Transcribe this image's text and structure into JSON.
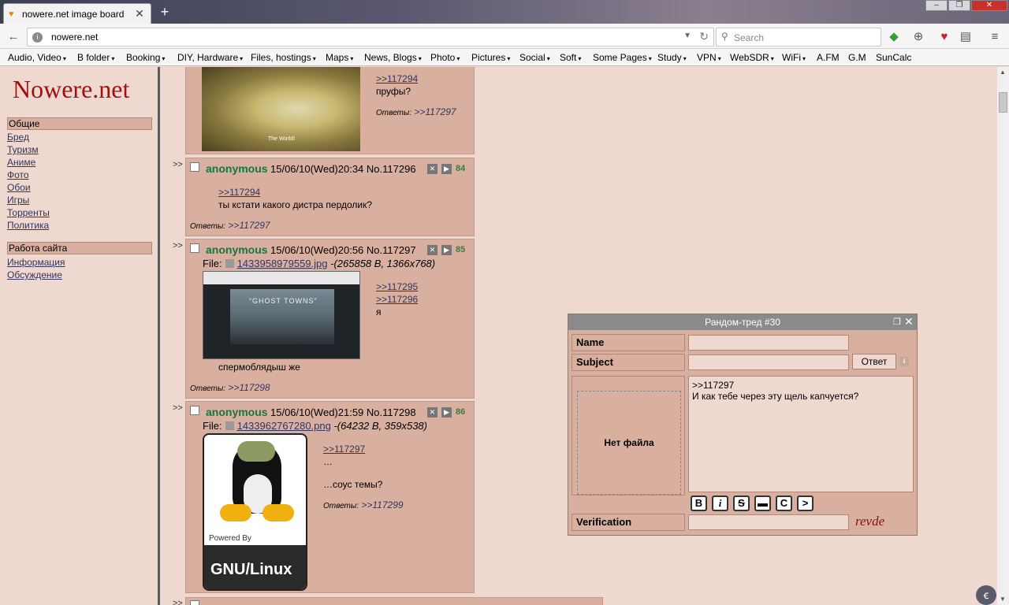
{
  "browser": {
    "tab_title": "nowere.net image board",
    "new_tab": "+",
    "url": "nowere.net",
    "search_placeholder": "Search",
    "bookmarks": [
      {
        "label": "Audio, Video",
        "arrow": "▾"
      },
      {
        "label": "B folder",
        "arrow": "▾"
      },
      {
        "label": "Booking",
        "arrow": "▾"
      },
      {
        "label": "DIY, Hardware",
        "arrow": "▾"
      },
      {
        "label": "Files, hostings",
        "arrow": "▾"
      },
      {
        "label": "Maps",
        "arrow": "▾"
      },
      {
        "label": "News, Blogs",
        "arrow": "▾"
      },
      {
        "label": "Photo",
        "arrow": "▾"
      },
      {
        "label": "Pictures",
        "arrow": "▾"
      },
      {
        "label": "Social",
        "arrow": "▾"
      },
      {
        "label": "Soft",
        "arrow": "▾"
      },
      {
        "label": "Some Pages",
        "arrow": "▾"
      },
      {
        "label": "Study",
        "arrow": "▾"
      },
      {
        "label": "VPN",
        "arrow": "▾"
      },
      {
        "label": "WebSDR",
        "arrow": "▾"
      },
      {
        "label": "WiFi",
        "arrow": "▾"
      },
      {
        "label": "A.FM",
        "arrow": ""
      },
      {
        "label": "G.M",
        "arrow": ""
      },
      {
        "label": "SunCalc",
        "arrow": ""
      }
    ]
  },
  "sidebar": {
    "site_title": "Nowere.net",
    "section1": "Общие",
    "links1": [
      "Бред",
      "Туризм",
      "Аниме",
      "Фото",
      "Обои",
      "Игры",
      "Торренты",
      "Политика"
    ],
    "section2": "Работа сайта",
    "links2": [
      "Информация",
      "Обсуждение"
    ]
  },
  "posts": [
    {
      "ref": ">>117294",
      "text": "пруфы?",
      "replies_label": "Ответы:",
      "replies": ">>117297",
      "img_caption": "The World!"
    },
    {
      "arrow": ">>",
      "name": "anonymous",
      "meta": "15/06/10(Wed)20:34 No.117296",
      "count": "84",
      "ref": ">>117294",
      "text": "ты кстати какого дистра пердолик?",
      "replies_label": "Ответы:",
      "replies": ">>117297"
    },
    {
      "arrow": ">>",
      "name": "anonymous",
      "meta": "15/06/10(Wed)20:56 No.117297",
      "count": "85",
      "file_label": "File:",
      "file_name": "1433958979559.jpg",
      "file_info": " -(265858 B, 1366x768)",
      "refs": [
        ">>117295",
        ">>117296"
      ],
      "text1": "я",
      "text2": "спермоблядыш же",
      "replies_label": "Ответы:",
      "replies": ">>117298",
      "img_caption": "“GHOST TOWNS”"
    },
    {
      "arrow": ">>",
      "name": "anonymous",
      "meta": "15/06/10(Wed)21:59 No.117298",
      "count": "86",
      "file_label": "File:",
      "file_name": "1433962767280.png",
      "file_info": " -(64232 B, 359x538)",
      "ref": ">>117297",
      "text1": "…",
      "text2": "…соус темы?",
      "replies_label": "Ответы:",
      "replies": ">>117299",
      "img_powered": "Powered By",
      "img_gnu": "GNU/Linux"
    },
    {
      "arrow": ">>"
    }
  ],
  "popup": {
    "title": "Рандом-тред #30",
    "name_label": "Name",
    "subject_label": "Subject",
    "send": "Ответ",
    "nofile": "Нет файла",
    "message_line1": ">>117297",
    "message_line2": "И как тебе через эту щель капчуется?",
    "format_buttons": [
      "B",
      "i",
      "S",
      "▬",
      "C",
      ">"
    ],
    "verification_label": "Verification",
    "captcha": "revde"
  }
}
